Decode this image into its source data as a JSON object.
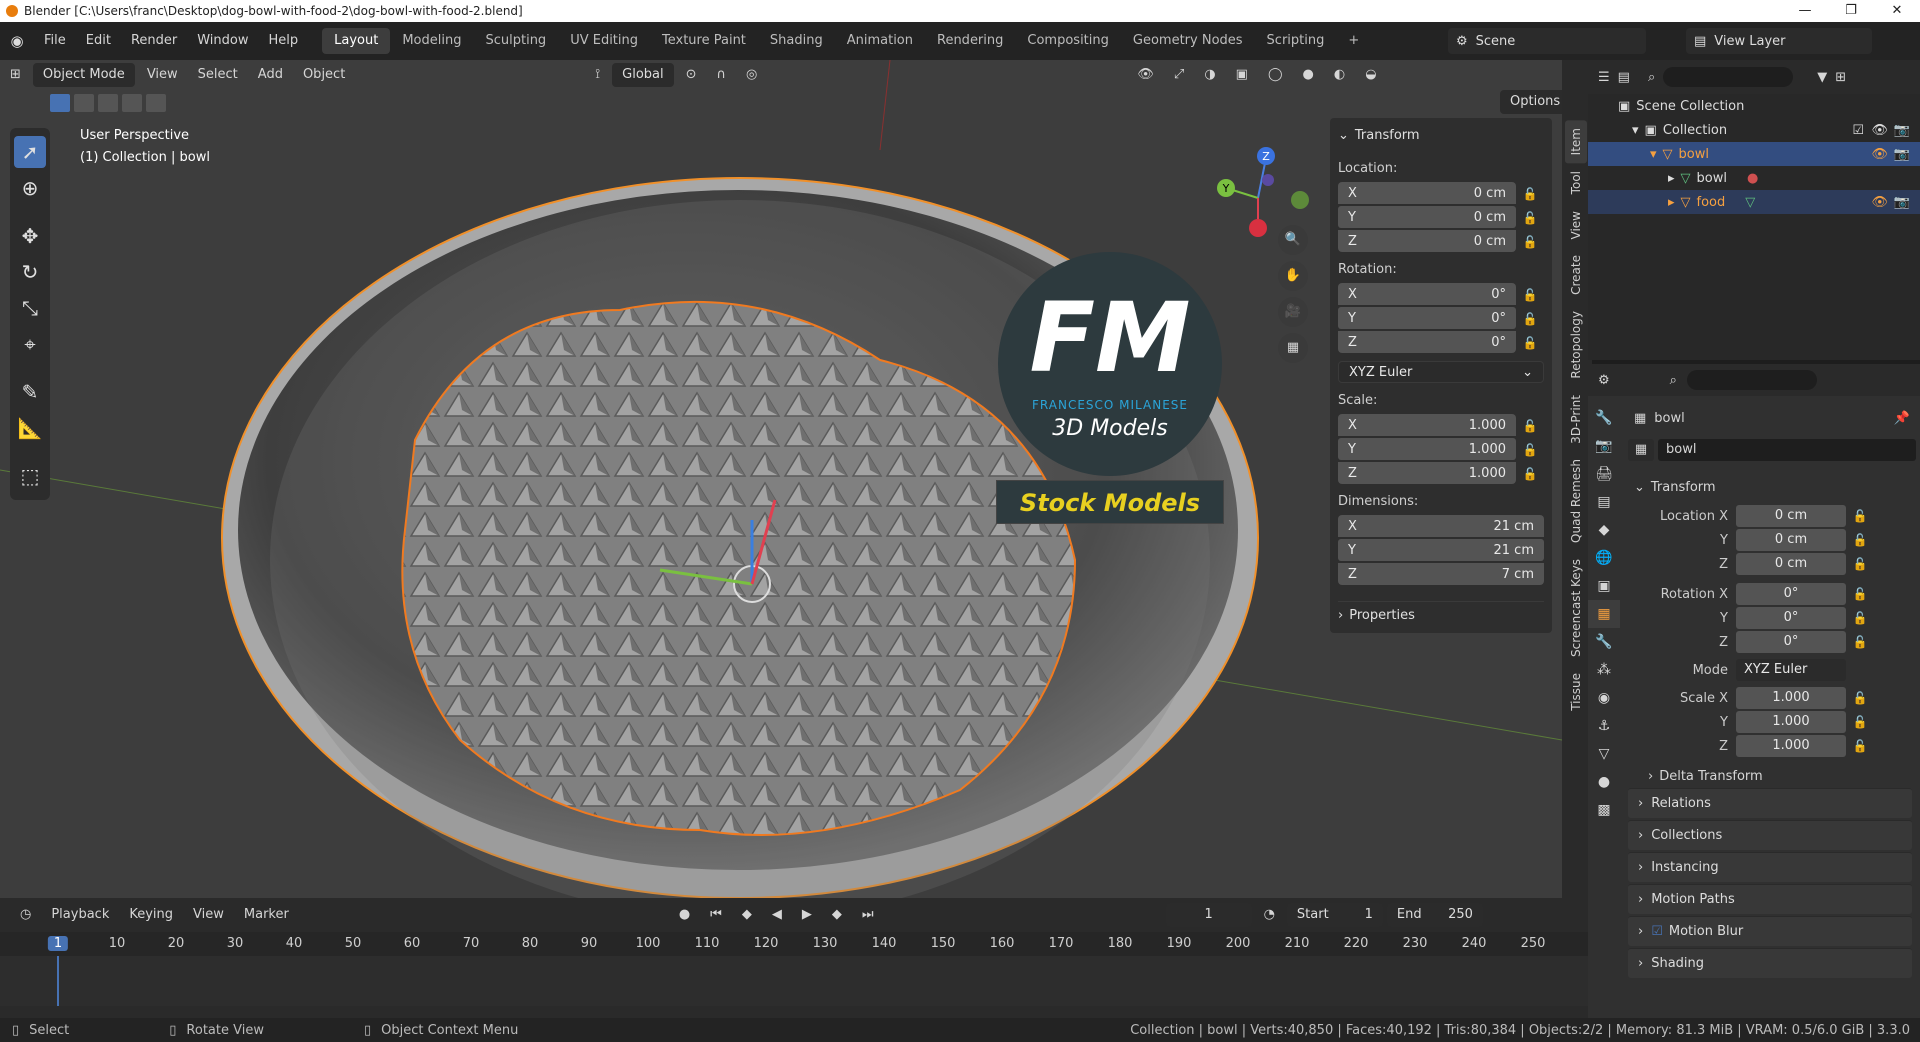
{
  "titlebar": {
    "title": "Blender [C:\\Users\\franc\\Desktop\\dog-bowl-with-food-2\\dog-bowl-with-food-2.blend]",
    "controls": [
      "—",
      "❐",
      "✕"
    ]
  },
  "menu": [
    "File",
    "Edit",
    "Render",
    "Window",
    "Help"
  ],
  "workspaces": [
    "Layout",
    "Modeling",
    "Sculpting",
    "UV Editing",
    "Texture Paint",
    "Shading",
    "Animation",
    "Rendering",
    "Compositing",
    "Geometry Nodes",
    "Scripting"
  ],
  "active_workspace": "Layout",
  "add_tab": "+",
  "scene": "Scene",
  "view_layer": "View Layer",
  "viewport_header": {
    "mode": "Object Mode",
    "menus": [
      "View",
      "Select",
      "Add",
      "Object"
    ],
    "orientation": "Global",
    "options": "Options"
  },
  "viewport": {
    "perspective": "User Perspective",
    "collection_info": "(1) Collection | bowl",
    "watermark_brand": "FM",
    "watermark_name": "FRANCESCO MILANESE",
    "watermark_sub": "3D Models",
    "watermark_banner": "Stock Models",
    "gizmo_axes": [
      "X",
      "Y",
      "Z"
    ]
  },
  "npanel": {
    "title": "Transform",
    "location_label": "Location:",
    "location": [
      {
        "axis": "X",
        "value": "0 cm"
      },
      {
        "axis": "Y",
        "value": "0 cm"
      },
      {
        "axis": "Z",
        "value": "0 cm"
      }
    ],
    "rotation_label": "Rotation:",
    "rotation": [
      {
        "axis": "X",
        "value": "0°"
      },
      {
        "axis": "Y",
        "value": "0°"
      },
      {
        "axis": "Z",
        "value": "0°"
      }
    ],
    "rotation_mode": "XYZ Euler",
    "scale_label": "Scale:",
    "scale": [
      {
        "axis": "X",
        "value": "1.000"
      },
      {
        "axis": "Y",
        "value": "1.000"
      },
      {
        "axis": "Z",
        "value": "1.000"
      }
    ],
    "dimensions_label": "Dimensions:",
    "dimensions": [
      {
        "axis": "X",
        "value": "21 cm"
      },
      {
        "axis": "Y",
        "value": "21 cm"
      },
      {
        "axis": "Z",
        "value": "7 cm"
      }
    ],
    "properties": "Properties"
  },
  "side_tabs": [
    "Item",
    "Tool",
    "View",
    "Create",
    "Retopology",
    "3D-Print",
    "Quad Remesh",
    "Screencast Keys",
    "Tissue"
  ],
  "outliner": {
    "scene_collection": "Scene Collection",
    "collection": "Collection",
    "items": [
      {
        "name": "bowl",
        "level": 1,
        "selected": true
      },
      {
        "name": "bowl",
        "level": 2,
        "selected": false
      },
      {
        "name": "food",
        "level": 2,
        "selected": false
      }
    ]
  },
  "properties": {
    "object_name": "bowl",
    "data_name": "bowl",
    "transform_title": "Transform",
    "location": [
      {
        "label": "Location X",
        "value": "0 cm"
      },
      {
        "label": "Y",
        "value": "0 cm"
      },
      {
        "label": "Z",
        "value": "0 cm"
      }
    ],
    "rotation": [
      {
        "label": "Rotation X",
        "value": "0°"
      },
      {
        "label": "Y",
        "value": "0°"
      },
      {
        "label": "Z",
        "value": "0°"
      }
    ],
    "mode_label": "Mode",
    "mode_value": "XYZ Euler",
    "scale": [
      {
        "label": "Scale X",
        "value": "1.000"
      },
      {
        "label": "Y",
        "value": "1.000"
      },
      {
        "label": "Z",
        "value": "1.000"
      }
    ],
    "delta": "Delta Transform",
    "sections": [
      "Relations",
      "Collections",
      "Instancing",
      "Motion Paths",
      "Motion Blur",
      "Shading"
    ]
  },
  "timeline": {
    "menus": [
      "Playback",
      "Keying",
      "View",
      "Marker"
    ],
    "current_frame": "1",
    "start_label": "Start",
    "start": "1",
    "end_label": "End",
    "end": "250",
    "ticks": [
      "1",
      "10",
      "20",
      "30",
      "40",
      "50",
      "60",
      "70",
      "80",
      "90",
      "100",
      "110",
      "120",
      "130",
      "140",
      "150",
      "160",
      "170",
      "180",
      "190",
      "200",
      "210",
      "220",
      "230",
      "240",
      "250"
    ]
  },
  "statusbar": {
    "select": "Select",
    "rotate": "Rotate View",
    "context": "Object Context Menu",
    "stats": "Collection | bowl | Verts:40,850 | Faces:40,192 | Tris:80,384 | Objects:2/2 | Memory: 81.3 MiB | VRAM: 0.5/6.0 GiB | 3.3.0"
  },
  "colors": {
    "accent": "#4772b3",
    "selection": "#f5a040",
    "active_tab": "#3d3d3d",
    "banner": "#e8d020"
  }
}
